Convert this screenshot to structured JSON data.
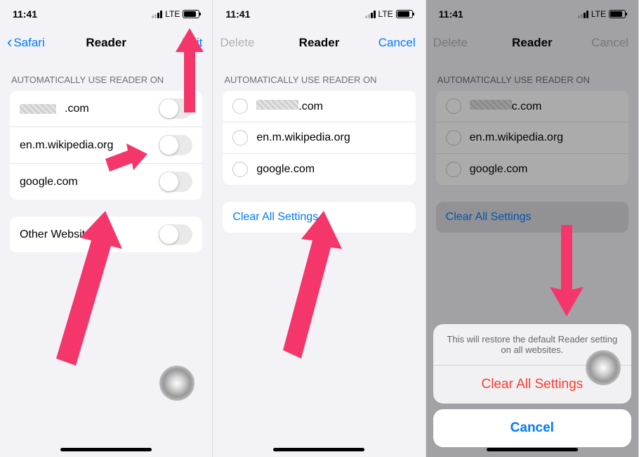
{
  "statusbar": {
    "time": "11:41",
    "network": "LTE"
  },
  "screen1": {
    "nav": {
      "back": "Safari",
      "title": "Reader",
      "action": "Edit"
    },
    "section_header": "AUTOMATICALLY USE READER ON",
    "sites": [
      {
        "suffix": ".com"
      },
      {
        "label": "en.m.wikipedia.org"
      },
      {
        "label": "google.com"
      }
    ],
    "other_label": "Other Websites"
  },
  "screen2": {
    "nav": {
      "left": "Delete",
      "title": "Reader",
      "right": "Cancel"
    },
    "section_header": "AUTOMATICALLY USE READER ON",
    "sites": [
      {
        "suffix": ".com"
      },
      {
        "label": "en.m.wikipedia.org"
      },
      {
        "label": "google.com"
      }
    ],
    "clear_label": "Clear All Settings"
  },
  "screen3": {
    "nav": {
      "left": "Delete",
      "title": "Reader",
      "right": "Cancel"
    },
    "section_header": "AUTOMATICALLY USE READER ON",
    "sites": [
      {
        "suffix": "c.com"
      },
      {
        "label": "en.m.wikipedia.org"
      },
      {
        "label": "google.com"
      }
    ],
    "clear_label": "Clear All Settings",
    "sheet": {
      "message": "This will restore the default Reader setting on all websites.",
      "action": "Clear All Settings",
      "cancel": "Cancel"
    }
  }
}
